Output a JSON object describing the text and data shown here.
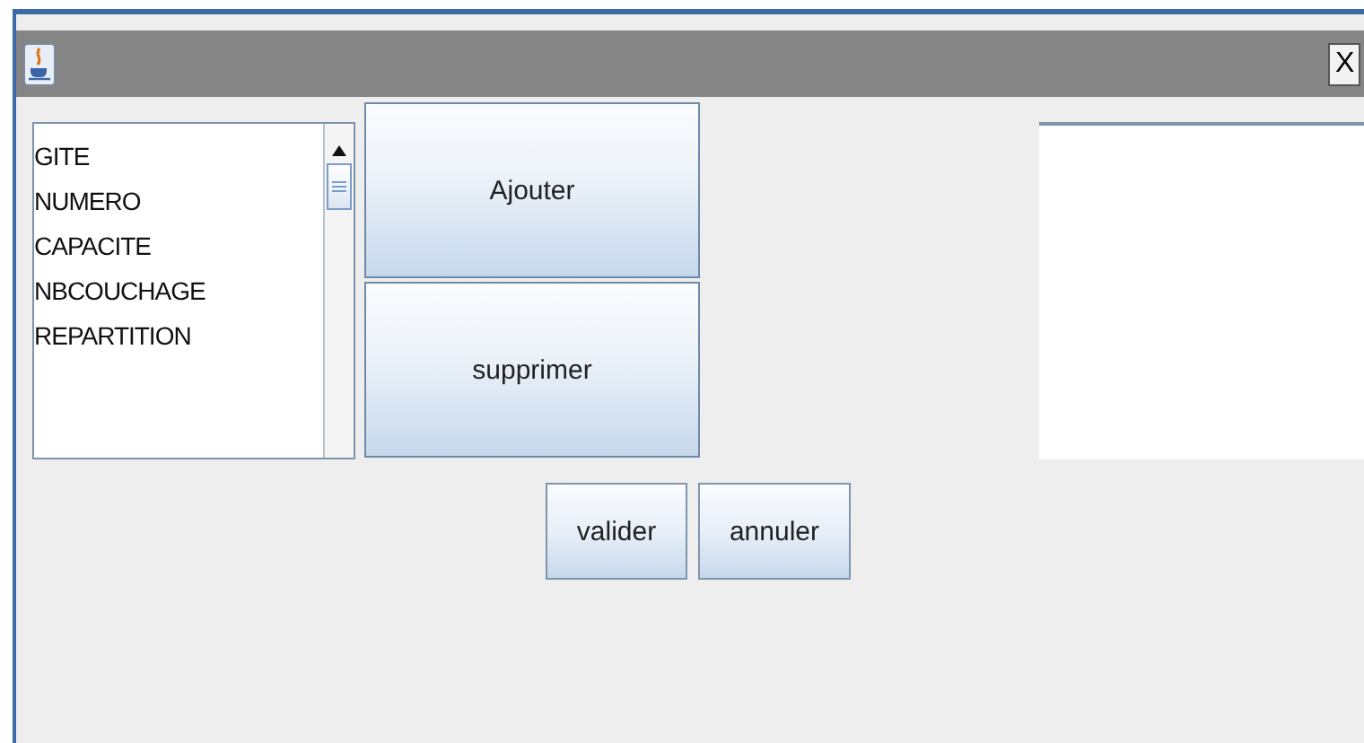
{
  "window": {
    "close_label": "X"
  },
  "list": {
    "items": [
      {
        "label": "GITE"
      },
      {
        "label": "NUMERO"
      },
      {
        "label": "CAPACITE"
      },
      {
        "label": "NBCOUCHAGE"
      },
      {
        "label": "REPARTITION"
      }
    ]
  },
  "side_buttons": [
    "Ajouter",
    "supprimer"
  ],
  "bottom_buttons": [
    "valider",
    "annuler"
  ]
}
